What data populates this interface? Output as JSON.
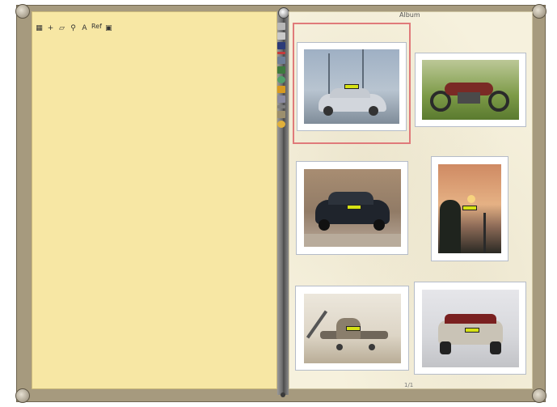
{
  "book": {
    "right_page_label": "Album",
    "page_number": "1/1"
  },
  "left_toolbar": {
    "items": [
      {
        "icon": "grid-icon",
        "glyph": "▦"
      },
      {
        "icon": "plus-icon",
        "glyph": "+"
      },
      {
        "icon": "crop-icon",
        "glyph": "▱"
      },
      {
        "icon": "zoom-icon",
        "glyph": "⚲"
      },
      {
        "icon": "text-icon",
        "glyph": "A"
      },
      {
        "icon": "font-icon",
        "glyph": "Ref"
      },
      {
        "icon": "image-icon",
        "glyph": "▣"
      }
    ]
  },
  "side_toolbar": {
    "tools": [
      {
        "name": "open-icon",
        "color": "#b7b7b7"
      },
      {
        "name": "list-icon",
        "color": "#c9c9c9"
      },
      {
        "name": "save-icon",
        "color": "#2c3b78"
      },
      {
        "name": "cut-icon",
        "color": "#c53a3a"
      },
      {
        "name": "photo-icon",
        "color": "#6e7e96"
      },
      {
        "name": "export-icon",
        "color": "#3e7a3e"
      },
      {
        "name": "globe-icon",
        "color": "#52a06a"
      },
      {
        "name": "warning-icon",
        "color": "#d69a21"
      },
      {
        "name": "settings-icon",
        "color": "#8a8aa0"
      },
      {
        "name": "link-icon",
        "color": "#7d7d7d"
      },
      {
        "name": "print-icon",
        "color": "#9c8f6e"
      },
      {
        "name": "help-icon",
        "color": "#e0b03a"
      }
    ]
  },
  "photos": [
    {
      "subject": "silver sedan",
      "sky": "#aab8c8",
      "ground": "#7e8e9e",
      "accent": "#d0d4d9"
    },
    {
      "subject": "vintage motorcycle",
      "sky": "#b6c590",
      "ground": "#5f7e36",
      "accent": "#7a2a25"
    },
    {
      "subject": "dark bmw sedan",
      "sky": "#a58c73",
      "ground": "#8a7766",
      "accent": "#1e232b"
    },
    {
      "subject": "sunset tree",
      "sky": "#d79a6e",
      "ground": "#2b2a24",
      "accent": "#f7d37e"
    },
    {
      "subject": "yellow airplane",
      "sky": "#e8e2d6",
      "ground": "#b9ad97",
      "accent": "#6f665a"
    },
    {
      "subject": "silver convertible",
      "sky": "#e2e2e6",
      "ground": "#c8c9cd",
      "accent": "#7a2020"
    }
  ]
}
